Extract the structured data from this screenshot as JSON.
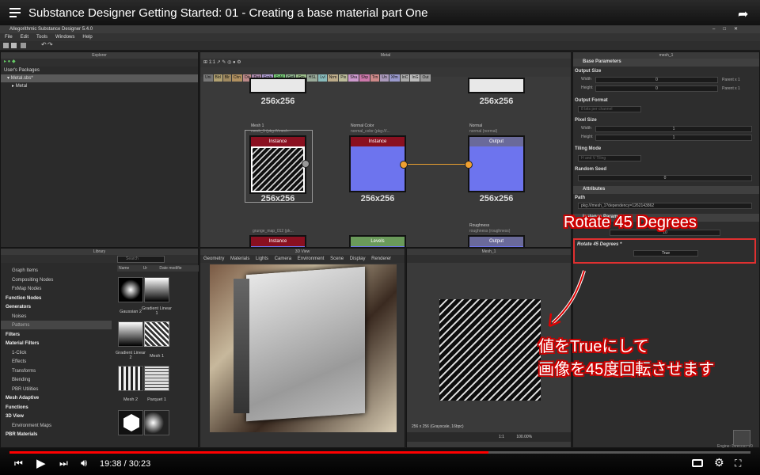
{
  "video": {
    "title": "Substance Designer Getting Started: 01 - Creating a base material part One",
    "time": "19:38 / 30:23",
    "progress": 0.646
  },
  "app": {
    "title": "Allegorithmic Substance Designer 5.4.0",
    "menu": [
      "File",
      "Edit",
      "Tools",
      "Windows",
      "Help"
    ]
  },
  "explorer": {
    "title": "Explorer",
    "root": "User's Packages",
    "package": "Metal.sbs*",
    "graph": "Metal"
  },
  "graph": {
    "title": "Metal",
    "zoom": "1:1",
    "chips": [
      {
        "t": "Uni",
        "c": "#777"
      },
      {
        "t": "Bld",
        "c": "#b0a070"
      },
      {
        "t": "Blr",
        "c": "#a08a60"
      },
      {
        "t": "Chn",
        "c": "#b09060"
      },
      {
        "t": "Dir",
        "c": "#b88"
      },
      {
        "t": "Dst",
        "c": "#a8a"
      },
      {
        "t": "Emb",
        "c": "#a9c"
      },
      {
        "t": "FxM",
        "c": "#7c7"
      },
      {
        "t": "Grd",
        "c": "#8a8"
      },
      {
        "t": "Grn",
        "c": "#9b8"
      },
      {
        "t": "HSL",
        "c": "#9a9"
      },
      {
        "t": "Lvl",
        "c": "#8bb"
      },
      {
        "t": "Nrm",
        "c": "#ba8"
      },
      {
        "t": "Pix",
        "c": "#bb9"
      },
      {
        "t": "Sha",
        "c": "#c9c"
      },
      {
        "t": "Shp",
        "c": "#c7a"
      },
      {
        "t": "Trn",
        "c": "#c88"
      },
      {
        "t": "Un",
        "c": "#a9b"
      },
      {
        "t": "Xfm",
        "c": "#99c"
      },
      {
        "t": "InC",
        "c": "#aaa"
      },
      {
        "t": "InG",
        "c": "#bbb"
      },
      {
        "t": "Out",
        "c": "#999"
      }
    ],
    "nodes": [
      {
        "title": "Mesh 1",
        "sub": "mesh_1 (pkg:///mesh...",
        "head": "Instance",
        "size": "256x256"
      },
      {
        "title": "Normal Color",
        "sub": "normal_color (pkg:///...",
        "head": "Instance",
        "size": "256x256"
      },
      {
        "title": "Normal",
        "sub": "normal (normal)",
        "head": "Output",
        "size": "256x256"
      },
      {
        "title": "",
        "sub": "",
        "head": "",
        "size": "256x256"
      },
      {
        "title": "",
        "sub": "",
        "head": "",
        "size": "256x256"
      },
      {
        "title": "",
        "sub": "grunge_map_012 (pk...",
        "head": "Instance",
        "size": ""
      },
      {
        "title": "",
        "sub": "",
        "head": "Levels",
        "size": ""
      },
      {
        "title": "Roughness",
        "sub": "roughness (roughness)",
        "head": "Output",
        "size": ""
      }
    ]
  },
  "props": {
    "title": "mesh_1",
    "base": "Base Parameters",
    "output_size": "Output Size",
    "width": "Width",
    "width_val": "0",
    "width_note": "Parent x 1",
    "height": "Height",
    "height_val": "0",
    "height_note": "Parent x 1",
    "output_format": "Output Format",
    "output_format_val": "8 bits per channel",
    "pixel_size": "Pixel Size",
    "px_w": "Width",
    "px_w_val": "1",
    "px_h": "Height",
    "px_h_val": "1",
    "tiling": "Tiling Mode",
    "tiling_val": "H and V Tiling",
    "seed": "Random Seed",
    "seed_val": "0",
    "attributes": "Attributes",
    "path": "Path",
    "path_val": "pkg:///mesh_1?dependency=1262143862",
    "inst_params": "Instance Parameters",
    "inst_val": "10",
    "rotate": "Rotate 45 Degrees *",
    "rotate_val": "True"
  },
  "library": {
    "title": "Library",
    "search_placeholder": "Search",
    "cols": [
      "Name",
      "Ur",
      "Date modifie"
    ],
    "tree": [
      {
        "t": "Graph Items",
        "h": false
      },
      {
        "t": "Compositing Nodes",
        "h": false
      },
      {
        "t": "FxMap Nodes",
        "h": false
      },
      {
        "t": "Function Nodes",
        "h": true
      },
      {
        "t": "Generators",
        "h": true
      },
      {
        "t": "Noises",
        "h": false
      },
      {
        "t": "Patterns",
        "h": false
      },
      {
        "t": "Filters",
        "h": true
      },
      {
        "t": "Material Filters",
        "h": true
      },
      {
        "t": "1-Click",
        "h": false
      },
      {
        "t": "Effects",
        "h": false
      },
      {
        "t": "Transforms",
        "h": false
      },
      {
        "t": "Blending",
        "h": false
      },
      {
        "t": "PBR Utilities",
        "h": false
      },
      {
        "t": "Mesh Adaptive",
        "h": true
      },
      {
        "t": "Functions",
        "h": true
      },
      {
        "t": "3D View",
        "h": true
      },
      {
        "t": "Environment Maps",
        "h": false
      },
      {
        "t": "PBR Materials",
        "h": true
      }
    ],
    "thumbs": [
      "Gaussian 2",
      "Gradient Linear 1",
      "Gradient Linear 2",
      "Mesh 1",
      "Mesh 2",
      "Parquet 1"
    ]
  },
  "view3d": {
    "title": "3D View",
    "menu": [
      "Geometry",
      "Materials",
      "Lights",
      "Camera",
      "Environment",
      "Scene",
      "Display",
      "Renderer"
    ]
  },
  "view2d": {
    "title": "Mesh_1",
    "info": "256 x 256 (Grayscale, 16bpc)",
    "zoom": "100.00%",
    "ratio": "1:1"
  },
  "annotation": {
    "title": "Rotate 45 Degrees",
    "line1": "値をTrueにして",
    "line2": "画像を45度回転させます"
  },
  "engine": "Engine: Direct3D 10"
}
